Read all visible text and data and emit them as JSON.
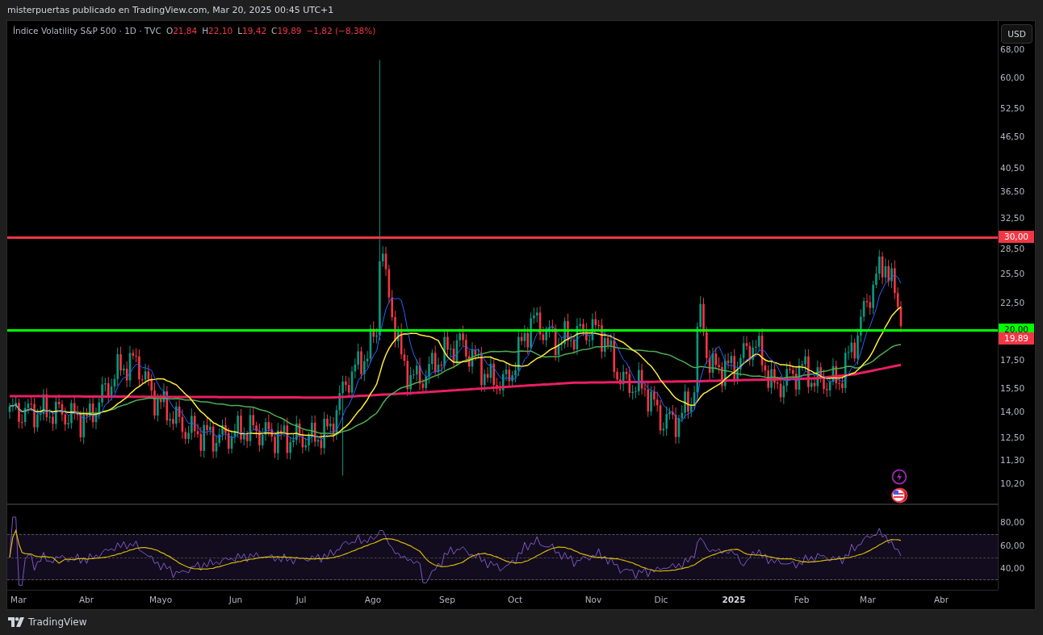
{
  "publisher_line": "misterpuertas publicado en TradingView.com, Mar 20, 2025 00:45 UTC+1",
  "legend": {
    "symbol": "Índice Volatility S&P 500 · 1D · TVC",
    "ohlc": [
      {
        "letter": "O",
        "value": "21,84"
      },
      {
        "letter": "H",
        "value": "22,10"
      },
      {
        "letter": "L",
        "value": "19,42"
      },
      {
        "letter": "C",
        "value": "19,89"
      }
    ],
    "change": "−1,82 (−8,38%)"
  },
  "currency_button": "USD",
  "price_axis": [
    "68,00",
    "60,00",
    "52,50",
    "46,50",
    "40,50",
    "36,50",
    "32,50",
    "28,50",
    "25,50",
    "22,50",
    "17,50",
    "15,50",
    "14,00",
    "12,50",
    "11,30",
    "10,20"
  ],
  "horizontal_levels": [
    {
      "label": "30,00",
      "color": "#f23645"
    },
    {
      "label": "20,00",
      "color": "#00ff00"
    }
  ],
  "last_price": {
    "label": "19,89"
  },
  "rsi_axis": [
    "80,00",
    "60,00",
    "40,00"
  ],
  "time_axis": [
    {
      "label": "Mar",
      "kind": "month"
    },
    {
      "label": "Abr",
      "kind": "month"
    },
    {
      "label": "Mayo",
      "kind": "month"
    },
    {
      "label": "Jun",
      "kind": "month"
    },
    {
      "label": "Jul",
      "kind": "month"
    },
    {
      "label": "Ago",
      "kind": "month"
    },
    {
      "label": "Sep",
      "kind": "month"
    },
    {
      "label": "Oct",
      "kind": "month"
    },
    {
      "label": "Nov",
      "kind": "month"
    },
    {
      "label": "Dic",
      "kind": "month"
    },
    {
      "label": "2025",
      "kind": "year"
    },
    {
      "label": "Feb",
      "kind": "month"
    },
    {
      "label": "Mar",
      "kind": "month"
    },
    {
      "label": "Abr",
      "kind": "month"
    }
  ],
  "footer": {
    "brand": "TradingView"
  }
}
